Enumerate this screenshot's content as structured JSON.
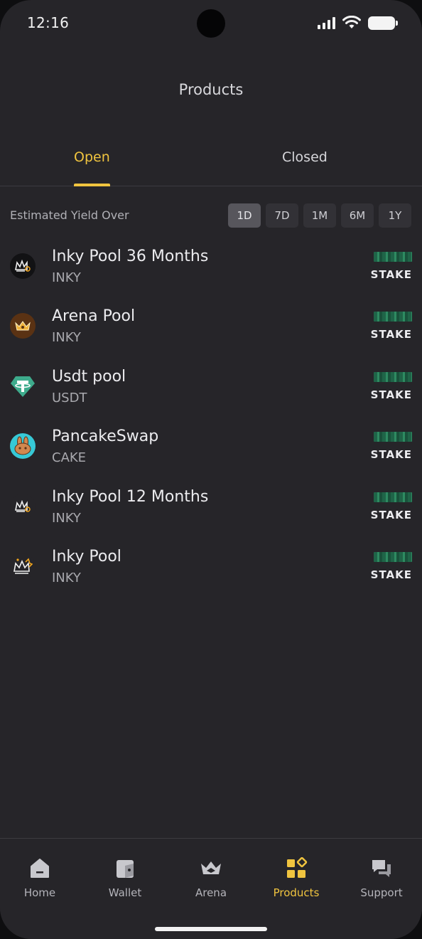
{
  "status_bar": {
    "time": "12:16"
  },
  "header": {
    "title": "Products"
  },
  "tabs": [
    {
      "label": "Open",
      "active": true
    },
    {
      "label": "Closed",
      "active": false
    }
  ],
  "yield": {
    "label": "Estimated Yield Over",
    "periods": [
      "1D",
      "7D",
      "1M",
      "6M",
      "1Y"
    ],
    "selected": "1D"
  },
  "products": [
    {
      "name": "Inky Pool 36 Months",
      "token": "INKY",
      "action": "STAKE",
      "icon": "inky-crown-icon"
    },
    {
      "name": "Arena Pool",
      "token": "INKY",
      "action": "STAKE",
      "icon": "arena-crown-icon"
    },
    {
      "name": "Usdt pool",
      "token": "USDT",
      "action": "STAKE",
      "icon": "tether-icon"
    },
    {
      "name": "PancakeSwap",
      "token": "CAKE",
      "action": "STAKE",
      "icon": "pancakeswap-bunny-icon"
    },
    {
      "name": "Inky Pool 12 Months",
      "token": "INKY",
      "action": "STAKE",
      "icon": "inky-crown-icon"
    },
    {
      "name": "Inky Pool",
      "token": "INKY",
      "action": "STAKE",
      "icon": "inky-crown-icon"
    }
  ],
  "nav": [
    {
      "label": "Home",
      "icon": "home-icon",
      "active": false
    },
    {
      "label": "Wallet",
      "icon": "wallet-icon",
      "active": false
    },
    {
      "label": "Arena",
      "icon": "arena-icon",
      "active": false
    },
    {
      "label": "Products",
      "icon": "products-grid-icon",
      "active": true
    },
    {
      "label": "Support",
      "icon": "chat-icon",
      "active": false
    }
  ],
  "colors": {
    "background": "#262529",
    "accent": "#f0c43f",
    "yield_green": "#2f9c6b"
  }
}
